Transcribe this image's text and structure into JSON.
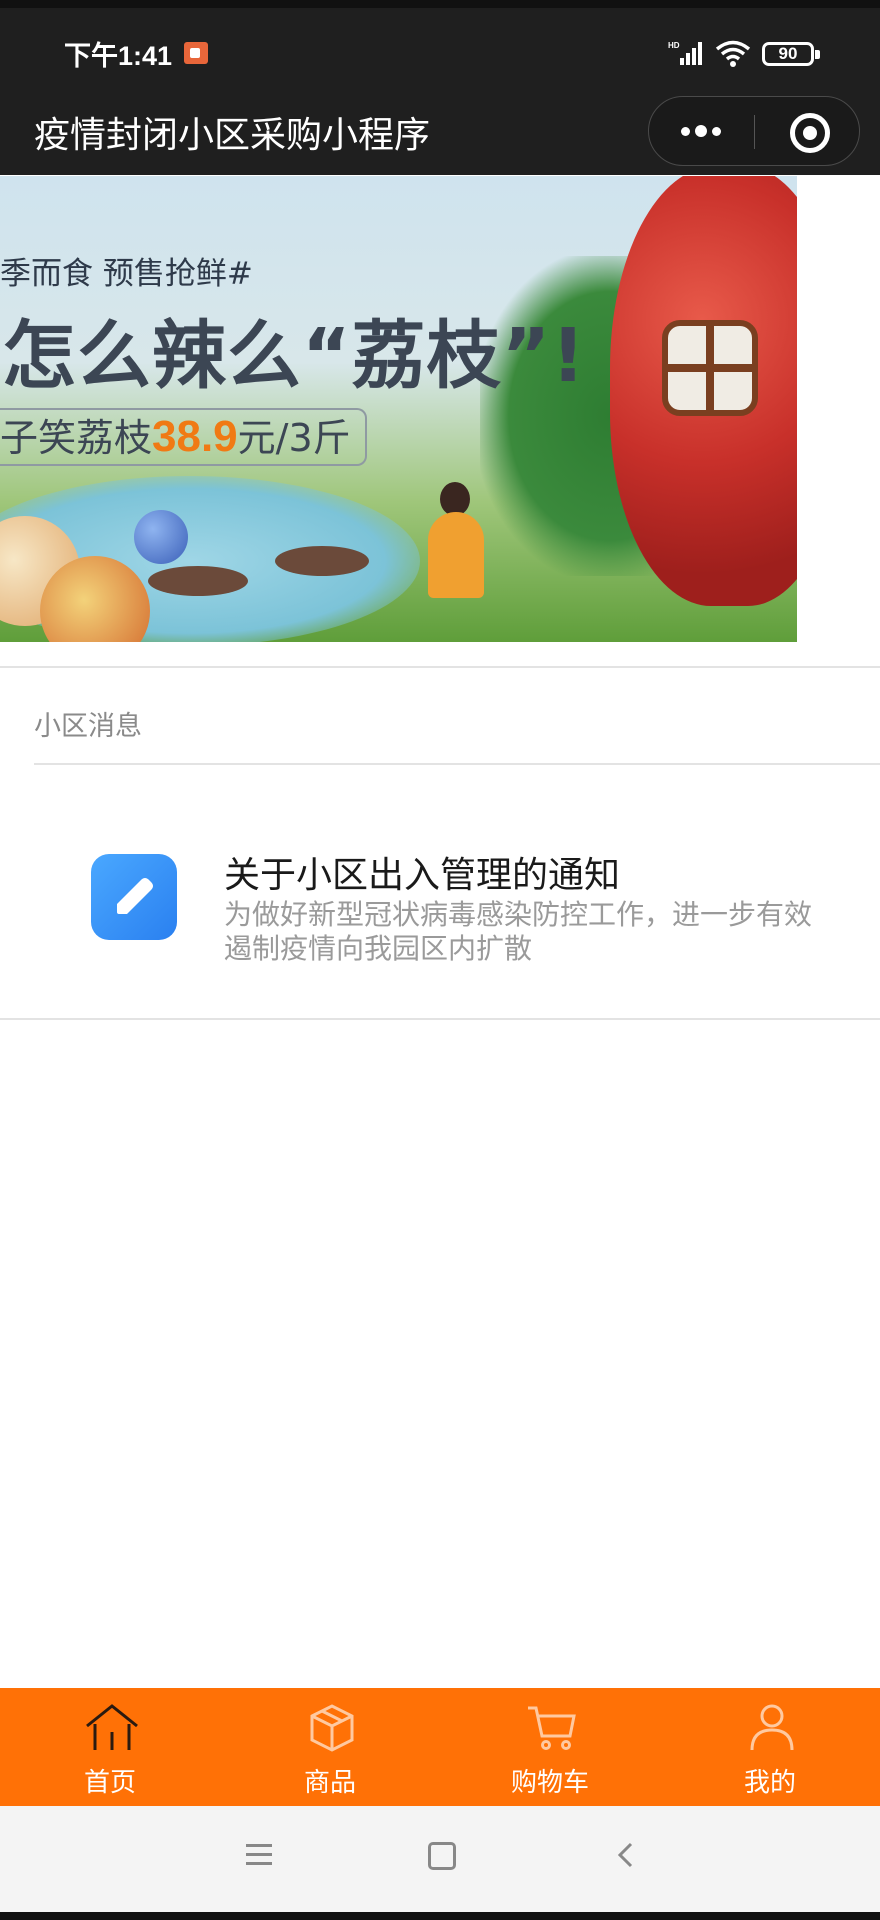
{
  "status_bar": {
    "time": "下午1:41",
    "battery": "90"
  },
  "header": {
    "title": "疫情封闭小区采购小程序"
  },
  "banner": {
    "line1": "季而食  预售抢鲜#",
    "line2": "怎么辣么“荔枝”!",
    "line3_prefix": "子笑荔枝",
    "line3_price": "38.9",
    "line3_suffix": "元/3斤"
  },
  "section": {
    "title": "小区消息"
  },
  "notices": [
    {
      "title": "关于小区出入管理的通知",
      "desc": "为做好新型冠状病毒感染防控工作，进一步有效遏制疫情向我园区内扩散",
      "icon": "edit-icon"
    }
  ],
  "tabbar": {
    "items": [
      {
        "label": "首页",
        "icon": "home-icon"
      },
      {
        "label": "商品",
        "icon": "box-icon"
      },
      {
        "label": "购物车",
        "icon": "cart-icon"
      },
      {
        "label": "我的",
        "icon": "user-icon"
      }
    ]
  },
  "colors": {
    "tabbar_bg": "#ff7106",
    "topbar_bg": "#1f1f1f",
    "price": "#f07a14"
  }
}
